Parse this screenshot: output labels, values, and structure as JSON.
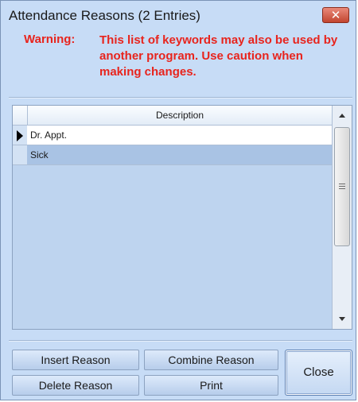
{
  "window": {
    "title": "Attendance Reasons (2 Entries)",
    "close_glyph": "✕"
  },
  "warning": {
    "label": "Warning:",
    "text": "This list of keywords may also be used by another program. Use caution when making changes.",
    "color": "#e8241d"
  },
  "grid": {
    "column_header": "Description",
    "rows": [
      {
        "description": "Dr. Appt.",
        "current": true
      },
      {
        "description": "Sick",
        "selected": true
      }
    ],
    "selected_row_color": "#a9c3e4"
  },
  "buttons": {
    "insert": "Insert Reason",
    "combine": "Combine Reason",
    "delete": "Delete Reason",
    "print": "Print",
    "close": "Close"
  },
  "icons": {
    "row_pointer": "row-pointer-icon",
    "scroll_up": "chevron-up-icon",
    "scroll_down": "chevron-down-icon"
  }
}
